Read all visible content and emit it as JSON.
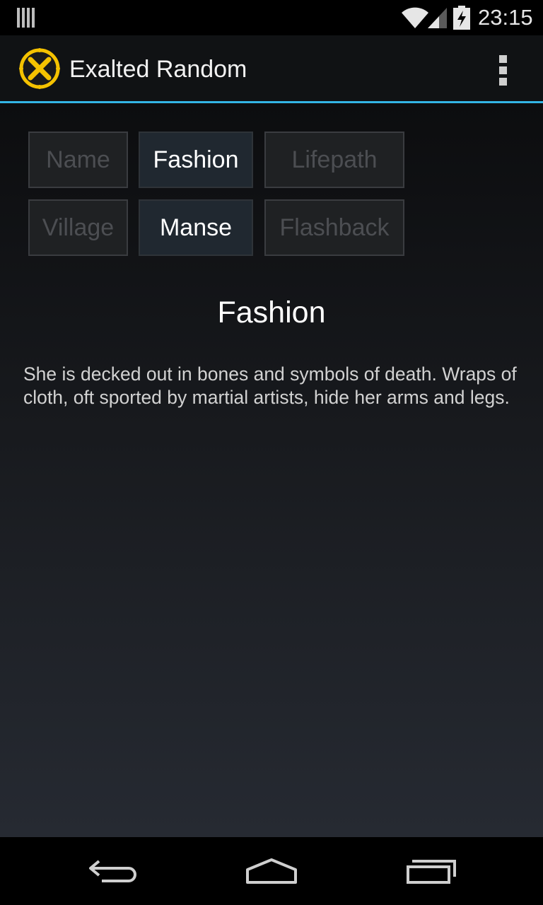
{
  "status_bar": {
    "time": "23:15",
    "icons": [
      "notification-bars-icon",
      "wifi-icon",
      "cell-signal-icon",
      "battery-charging-icon"
    ]
  },
  "action_bar": {
    "title": "Exalted Random",
    "app_icon": "exalted-logo-icon",
    "overflow_icon": "overflow-menu-icon"
  },
  "tabs": {
    "name": "Name",
    "fashion": "Fashion",
    "lifepath": "Lifepath",
    "village": "Village",
    "manse": "Manse",
    "flashback": "Flashback",
    "active": [
      "Fashion",
      "Manse"
    ]
  },
  "main": {
    "title": "Fashion",
    "description": "She is decked out in bones and symbols of death. Wraps of cloth, oft sported by martial artists, hide her arms and legs."
  },
  "nav_bar": {
    "icons": [
      "back-icon",
      "home-icon",
      "recent-apps-icon"
    ]
  },
  "colors": {
    "accent": "#33b5e5",
    "logo": "#f5c200",
    "action_bar_bg": "#101214"
  }
}
